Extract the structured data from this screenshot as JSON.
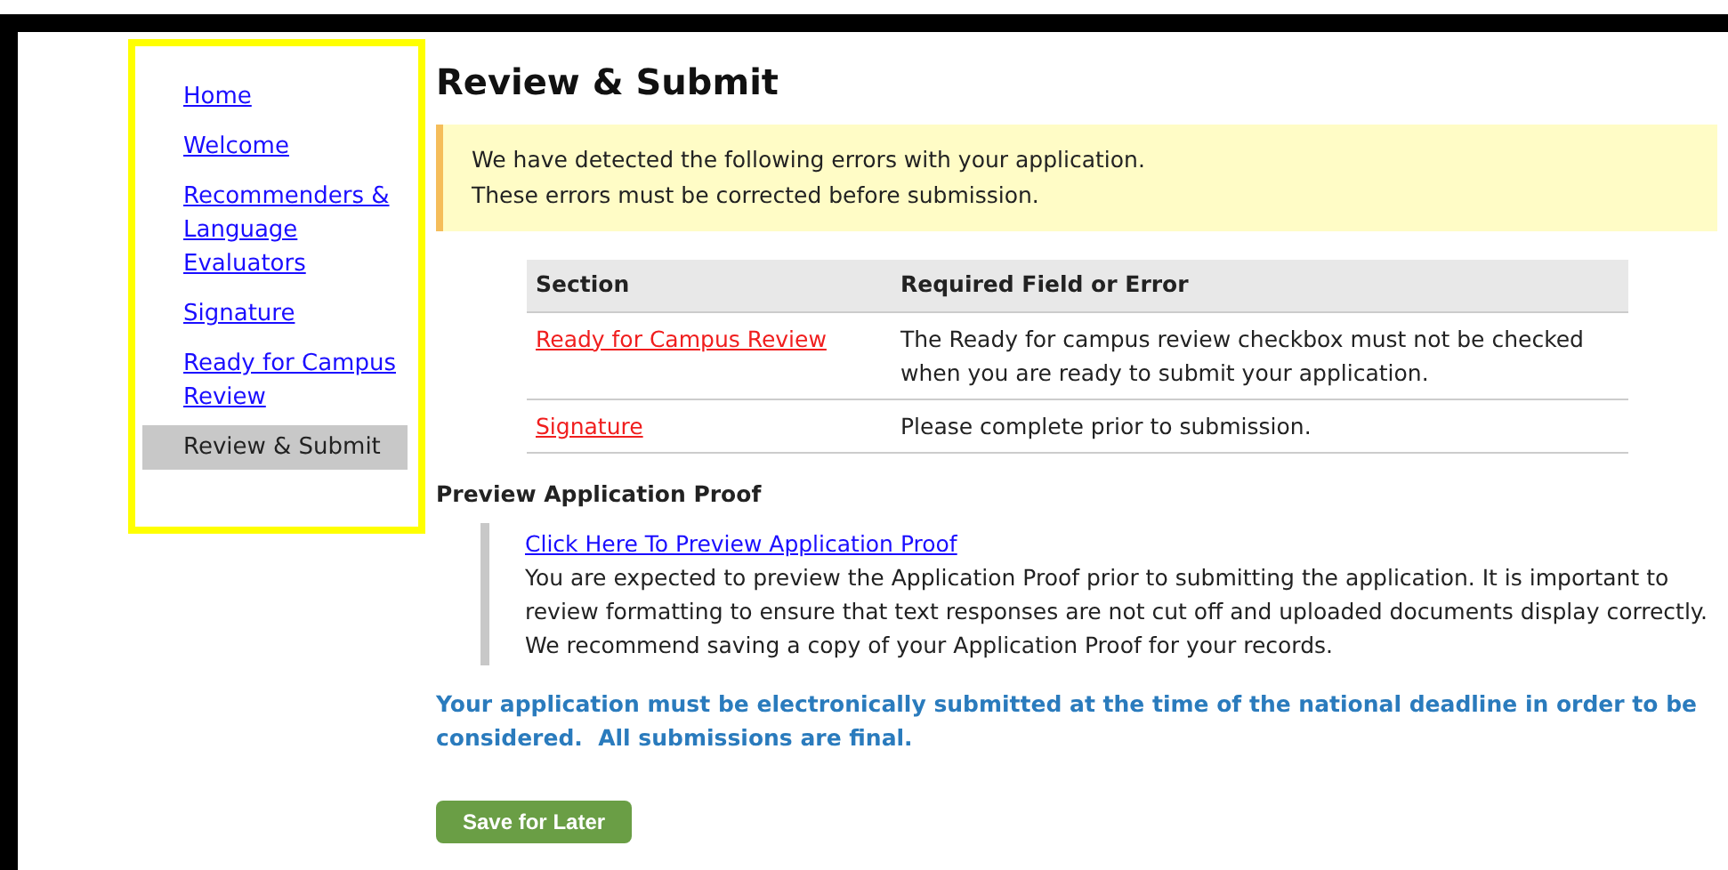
{
  "sidebar": {
    "items": [
      {
        "label": "Home",
        "selected": false
      },
      {
        "label": "Welcome",
        "selected": false
      },
      {
        "label": "Recommenders & Language Evaluators",
        "selected": false
      },
      {
        "label": "Signature",
        "selected": false
      },
      {
        "label": "Ready for Campus Review",
        "selected": false
      },
      {
        "label": "Review & Submit",
        "selected": true
      }
    ]
  },
  "page_title": "Review & Submit",
  "alert": {
    "lines": [
      "We have detected the following errors with your application.",
      "These errors must be corrected before submission."
    ]
  },
  "errors_table": {
    "columns": [
      "Section",
      "Required Field or Error"
    ],
    "rows": [
      {
        "section": "Ready for Campus Review",
        "error": "The Ready for campus review checkbox must not be checked when you are ready to submit your application."
      },
      {
        "section": "Signature",
        "error": "Please complete prior to submission."
      }
    ]
  },
  "preview": {
    "heading": "Preview Application Proof",
    "link": "Click Here To Preview Application Proof",
    "text": "You are expected to preview the Application Proof prior to submitting the application. It is important to review formatting to ensure that text responses are not cut off and uploaded documents display correctly. We recommend saving a copy of your Application Proof for your records."
  },
  "notice": "Your application must be electronically submitted at the time of the national deadline in order to be considered.  All submissions are final.",
  "buttons": [
    "Save for Later"
  ]
}
